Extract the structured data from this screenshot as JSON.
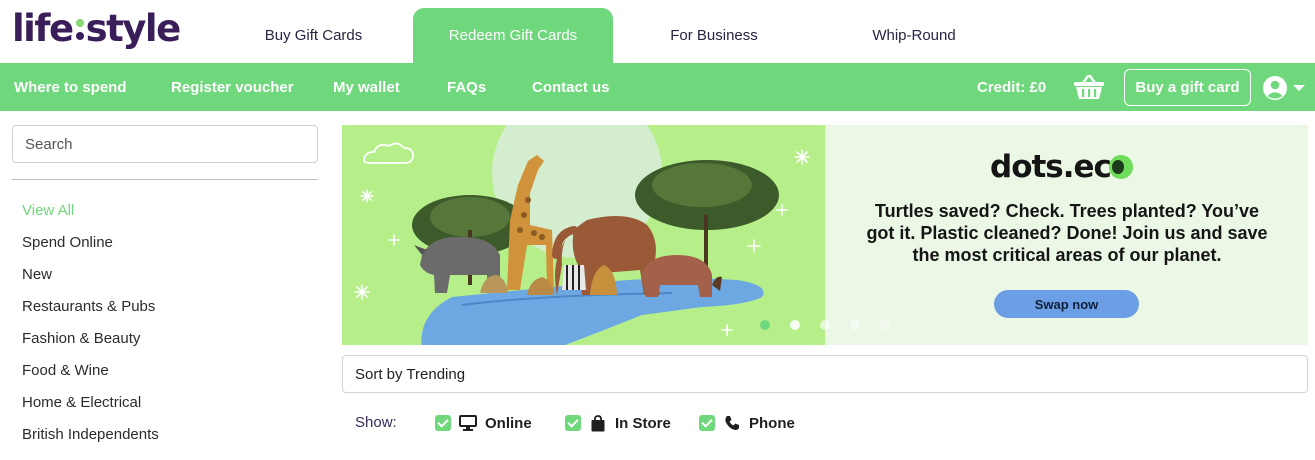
{
  "brand": {
    "logo_left": "life",
    "logo_right": "style"
  },
  "main_tabs": [
    {
      "label": "Buy Gift Cards",
      "active": false
    },
    {
      "label": "Redeem Gift Cards",
      "active": true
    },
    {
      "label": "For Business",
      "active": false
    },
    {
      "label": "Whip-Round",
      "active": false
    }
  ],
  "nav": {
    "links": [
      "Where to spend",
      "Register voucher",
      "My wallet",
      "FAQs",
      "Contact us"
    ],
    "credit": "Credit: £0",
    "basket_icon": "basket-icon",
    "buy_button": "Buy a gift card",
    "account_icon": "user-circle-icon"
  },
  "sidebar": {
    "search_placeholder": "Search",
    "categories": [
      {
        "label": "View All",
        "active": true
      },
      {
        "label": "Spend Online",
        "active": false
      },
      {
        "label": "New",
        "active": false
      },
      {
        "label": "Restaurants & Pubs",
        "active": false
      },
      {
        "label": "Fashion & Beauty",
        "active": false
      },
      {
        "label": "Food & Wine",
        "active": false
      },
      {
        "label": "Home & Electrical",
        "active": false
      },
      {
        "label": "British Independents",
        "active": false
      }
    ]
  },
  "banner": {
    "brand_text": "dots.ec",
    "headline": "Turtles saved? Check. Trees planted? You’ve got it. Plastic cleaned? Done! Join us and save the most critical areas of our planet.",
    "cta": "Swap now",
    "slide_count": 5,
    "active_slide": 1
  },
  "sort": {
    "label": "Sort by Trending"
  },
  "filters": {
    "show_label": "Show:",
    "items": [
      {
        "label": "Online",
        "icon": "monitor-icon",
        "checked": true
      },
      {
        "label": "In Store",
        "icon": "shopping-bag-icon",
        "checked": true
      },
      {
        "label": "Phone",
        "icon": "phone-icon",
        "checked": true
      }
    ]
  },
  "colors": {
    "green": "#6fd77c",
    "purple": "#3a1e59",
    "banner_bg": "#ebf8e6",
    "cta_blue": "#6b9ee5"
  }
}
